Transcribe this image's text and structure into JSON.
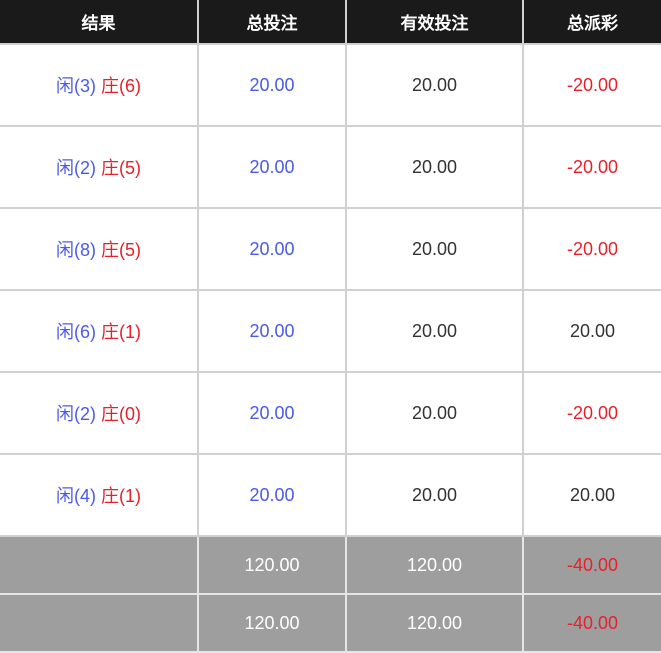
{
  "header": {
    "result": "结果",
    "total_bet": "总投注",
    "valid_bet": "有效投注",
    "total_payout": "总派彩"
  },
  "rows": [
    {
      "player": "闲(3)",
      "banker": "庄(6)",
      "total_bet": "20.00",
      "valid_bet": "20.00",
      "payout": "-20.00",
      "payout_negative": true
    },
    {
      "player": "闲(2)",
      "banker": "庄(5)",
      "total_bet": "20.00",
      "valid_bet": "20.00",
      "payout": "-20.00",
      "payout_negative": true
    },
    {
      "player": "闲(8)",
      "banker": "庄(5)",
      "total_bet": "20.00",
      "valid_bet": "20.00",
      "payout": "-20.00",
      "payout_negative": true
    },
    {
      "player": "闲(6)",
      "banker": "庄(1)",
      "total_bet": "20.00",
      "valid_bet": "20.00",
      "payout": "20.00",
      "payout_negative": false
    },
    {
      "player": "闲(2)",
      "banker": "庄(0)",
      "total_bet": "20.00",
      "valid_bet": "20.00",
      "payout": "-20.00",
      "payout_negative": true
    },
    {
      "player": "闲(4)",
      "banker": "庄(1)",
      "total_bet": "20.00",
      "valid_bet": "20.00",
      "payout": "20.00",
      "payout_negative": false
    }
  ],
  "summary": [
    {
      "label": "",
      "total_bet": "120.00",
      "valid_bet": "120.00",
      "payout": "-40.00"
    },
    {
      "label": "",
      "total_bet": "120.00",
      "valid_bet": "120.00",
      "payout": "-40.00"
    }
  ],
  "colors": {
    "player": "#4a5ae8",
    "banker": "#e8202a",
    "header_bg": "#1a1a1a",
    "summary_bg": "#9e9e9e"
  }
}
